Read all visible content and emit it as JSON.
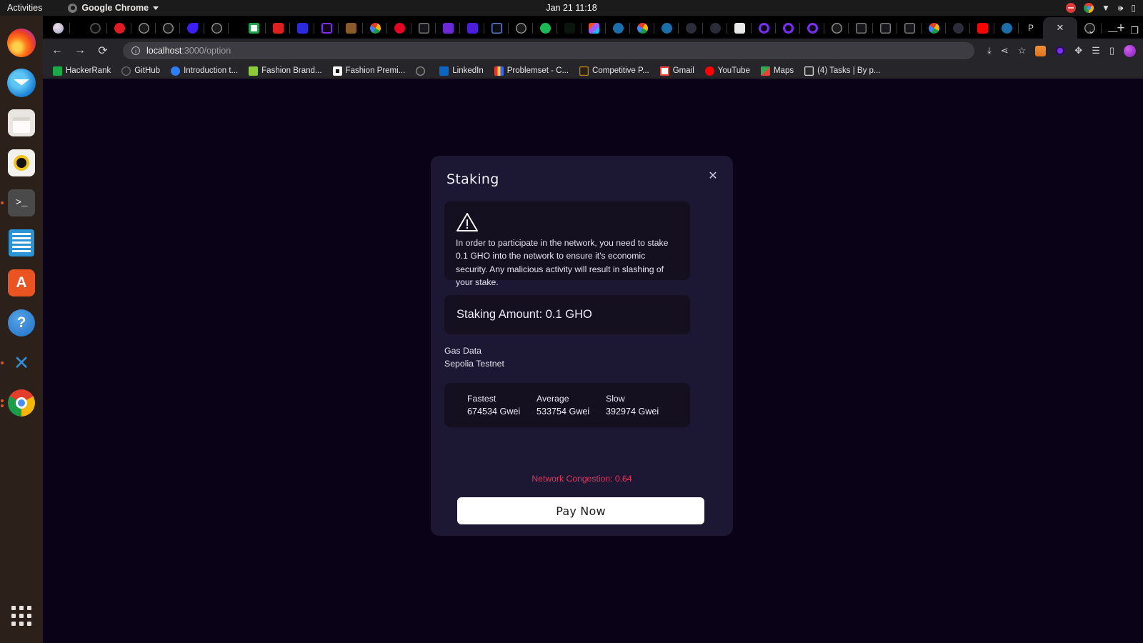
{
  "system": {
    "activities": "Activities",
    "app_name": "Google Chrome",
    "clock": "Jan 21  11:18",
    "tray": [
      "record-icon",
      "chrome-icon",
      "wifi-icon",
      "volume-muted-icon",
      "battery-icon"
    ]
  },
  "dock": {
    "items": [
      {
        "name": "firefox",
        "label": "Firefox"
      },
      {
        "name": "thunderbird",
        "label": "Thunderbird Mail"
      },
      {
        "name": "files",
        "label": "Files"
      },
      {
        "name": "rhythmbox",
        "label": "Rhythmbox"
      },
      {
        "name": "terminal",
        "label": "Terminal"
      },
      {
        "name": "libreoffice-writer",
        "label": "LibreOffice Writer"
      },
      {
        "name": "ubuntu-software",
        "label": "Ubuntu Software"
      },
      {
        "name": "help",
        "label": "Help"
      },
      {
        "name": "vscode",
        "label": "Visual Studio Code"
      },
      {
        "name": "chrome",
        "label": "Google Chrome"
      }
    ],
    "show_applications": "Show Applications"
  },
  "browser": {
    "tabs": [
      {
        "favicon": "profile-avatar"
      },
      {
        "favicon": "loop-dark"
      },
      {
        "favicon": "calendar-15",
        "badge": "15"
      },
      {
        "favicon": "github"
      },
      {
        "favicon": "github"
      },
      {
        "favicon": "blue-shape"
      },
      {
        "favicon": "github"
      },
      {
        "favicon": "leetcode-green"
      },
      {
        "favicon": "99d-red"
      },
      {
        "favicon": "f-blue"
      },
      {
        "favicon": "v-purple"
      },
      {
        "favicon": "brown-stack"
      },
      {
        "favicon": "google"
      },
      {
        "favicon": "pinterest"
      },
      {
        "favicon": "square-gray"
      },
      {
        "favicon": "a-purple"
      },
      {
        "favicon": "a-indigo"
      },
      {
        "favicon": "wave-blue"
      },
      {
        "favicon": "github"
      },
      {
        "favicon": "spotify"
      },
      {
        "favicon": "w-green"
      },
      {
        "favicon": "figma"
      },
      {
        "favicon": "diamond-blue"
      },
      {
        "favicon": "google"
      },
      {
        "favicon": "diamond-blue"
      },
      {
        "favicon": "moon-dark"
      },
      {
        "favicon": "moon-dark"
      },
      {
        "favicon": "book-white"
      },
      {
        "favicon": "ring-purple"
      },
      {
        "favicon": "ring-purple"
      },
      {
        "favicon": "ring-purple"
      },
      {
        "favicon": "github"
      },
      {
        "favicon": "square-gray"
      },
      {
        "favicon": "square-gray"
      },
      {
        "favicon": "square-gray"
      },
      {
        "favicon": "google"
      },
      {
        "favicon": "moon-dark"
      },
      {
        "favicon": "youtube"
      },
      {
        "favicon": "diamond-blue"
      },
      {
        "favicon": "p-letter"
      },
      {
        "favicon": "active-close",
        "active": true
      },
      {
        "favicon": "github"
      }
    ],
    "new_tab_label": "+",
    "tab_search_label": "⌄",
    "window_controls": {
      "minimize": "—",
      "maximize": "❐"
    },
    "nav": {
      "back": "←",
      "forward": "→",
      "reload": "⟳"
    },
    "address": {
      "host": "localhost",
      "path": ":3000/option",
      "info_icon": "ⓘ"
    },
    "toolbar_icons": [
      "install-app-icon",
      "share-icon",
      "bookmark-star-icon",
      "metamask-extension-icon",
      "wallet-extension-icon",
      "extensions-puzzle-icon",
      "reading-list-icon",
      "side-panel-icon",
      "profile-avatar-icon"
    ],
    "bookmarks": [
      {
        "label": "HackerRank",
        "icon": "hackerrank-icon",
        "color": "#1ba94c"
      },
      {
        "label": "GitHub",
        "icon": "github-icon",
        "color": "#3a3a3a"
      },
      {
        "label": "Introduction t...",
        "icon": "bookmark-blue-icon",
        "color": "#2d7ff9"
      },
      {
        "label": "Fashion Brand...",
        "icon": "fashion-bag-icon",
        "color": "#8ecb3a"
      },
      {
        "label": "Fashion Premi...",
        "icon": "fashion-dot-icon",
        "color": "#111111"
      },
      {
        "label": "",
        "icon": "github-icon",
        "color": "#2b2b2b"
      },
      {
        "label": "LinkedIn",
        "icon": "linkedin-icon",
        "color": "#0a66c2"
      },
      {
        "label": "Problemset - C...",
        "icon": "codeforces-icon",
        "color": "#1f6fd0"
      },
      {
        "label": "Competitive P...",
        "icon": "cc-icon",
        "color": "#b8860b"
      },
      {
        "label": "Gmail",
        "icon": "gmail-icon",
        "color": "#ea4335"
      },
      {
        "label": "YouTube",
        "icon": "youtube-icon",
        "color": "#ff0000"
      },
      {
        "label": "Maps",
        "icon": "google-maps-icon",
        "color": "#34a853"
      },
      {
        "label": "(4) Tasks | By p...",
        "icon": "notion-icon",
        "color": "#d8d8d8"
      }
    ]
  },
  "modal": {
    "title": "Staking",
    "close_label": "✕",
    "warning_icon": "warning-triangle-icon",
    "warning_text": "In order to participate in the network, you need to stake 0.1 GHO into the network to ensure it's economic security. Any malicious activity will result in slashing of your stake.",
    "staking_amount": "Staking Amount: 0.1 GHO",
    "gas_section_label": "Gas Data",
    "network_label": "Sepolia Testnet",
    "gas": [
      {
        "label": "Fastest",
        "value": "674534 Gwei"
      },
      {
        "label": "Average",
        "value": "533754 Gwei"
      },
      {
        "label": "Slow",
        "value": "392974 Gwei"
      }
    ],
    "congestion": "Network Congestion: 0.64",
    "pay_button": "Pay Now",
    "colors": {
      "page_background": "#0a0318",
      "modal_background": "#1c1733",
      "inner_box": "#15101f",
      "congestion_text": "#e0355f",
      "button_background": "#ffffff"
    }
  }
}
